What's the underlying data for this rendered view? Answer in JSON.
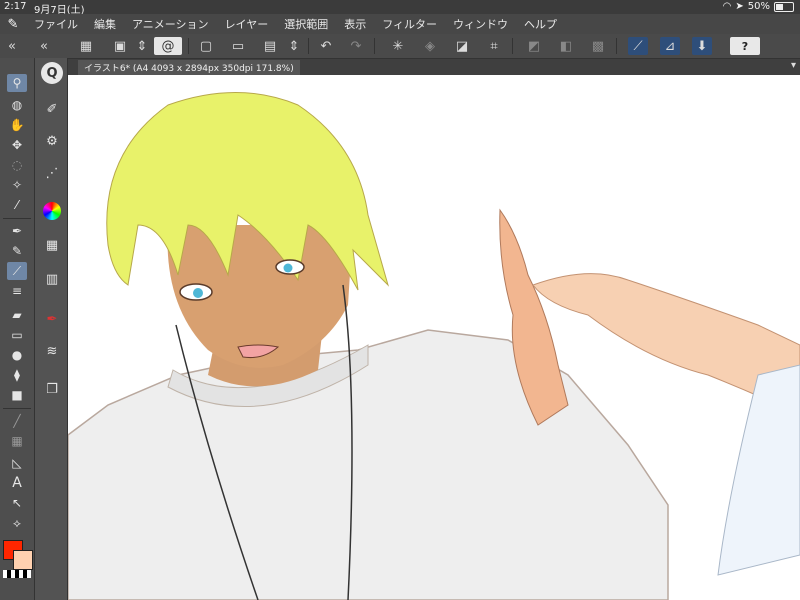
{
  "status": {
    "time": "2:17",
    "date": "9月7日(土)",
    "battery": "50%"
  },
  "menu": {
    "logo_icon": "csp-logo-icon",
    "items": [
      "ファイル",
      "編集",
      "アニメーション",
      "レイヤー",
      "選択範囲",
      "表示",
      "フィルター",
      "ウィンドウ",
      "ヘルプ"
    ]
  },
  "toolbar": {
    "help_label": "?"
  },
  "document": {
    "tab_title": "イラスト6* (A4 4093 x 2894px 350dpi 171.8%)"
  },
  "colors": {
    "main": "#ff2600",
    "sub": "#ffd1b0",
    "accent": "#2e4e7a"
  }
}
